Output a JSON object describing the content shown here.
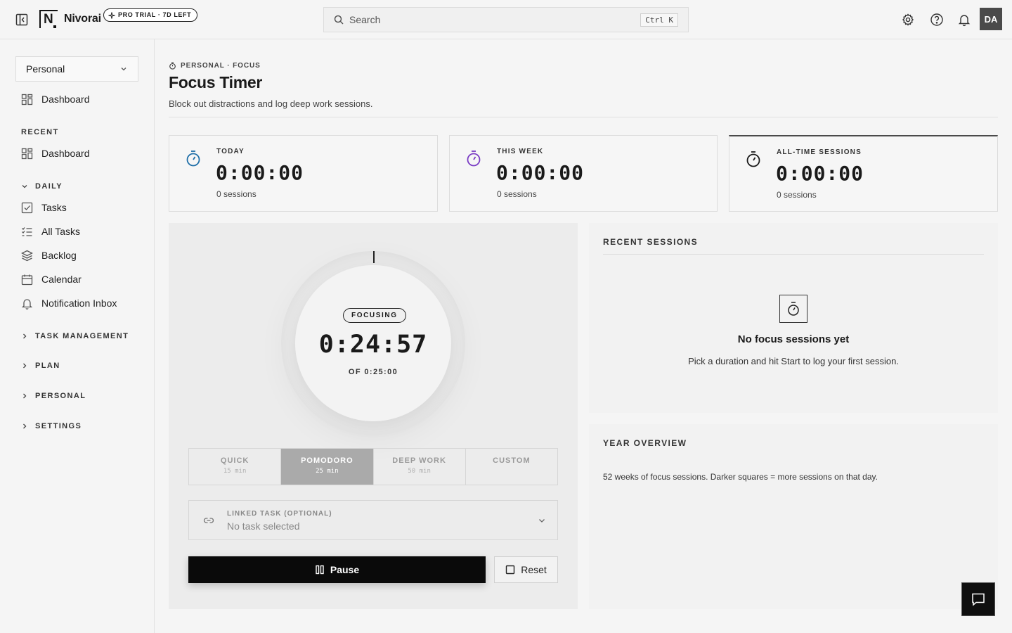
{
  "app": {
    "brand": "Nivorai",
    "logo_letter": "N",
    "trial_badge": "PRO TRIAL · 7D LEFT"
  },
  "search": {
    "placeholder": "Search",
    "shortcut": "Ctrl K"
  },
  "user": {
    "initials": "DA"
  },
  "sidebar": {
    "workspace": "Personal",
    "dashboard": "Dashboard",
    "recent_label": "RECENT",
    "recent_items": [
      "Dashboard"
    ],
    "daily_label": "DAILY",
    "daily_items": [
      "Tasks",
      "All Tasks",
      "Backlog",
      "Calendar",
      "Notification Inbox"
    ],
    "groups": [
      "TASK MANAGEMENT",
      "PLAN",
      "PERSONAL",
      "SETTINGS"
    ]
  },
  "page": {
    "breadcrumb": "PERSONAL · FOCUS",
    "title": "Focus Timer",
    "subtitle": "Block out distractions and log deep work sessions."
  },
  "stats": [
    {
      "label": "TODAY",
      "value": "0:00:00",
      "sub": "0 sessions",
      "color": "#1f6fa8"
    },
    {
      "label": "THIS WEEK",
      "value": "0:00:00",
      "sub": "0 sessions",
      "color": "#7a3cc4"
    },
    {
      "label": "ALL-TIME SESSIONS",
      "value": "0:00:00",
      "sub": "0 sessions",
      "color": "#1a1a1a"
    }
  ],
  "timer": {
    "status": "FOCUSING",
    "remaining": "0:24:57",
    "of": "OF 0:25:00"
  },
  "presets": [
    {
      "name": "QUICK",
      "min": "15 min",
      "selected": false
    },
    {
      "name": "POMODORO",
      "min": "25 min",
      "selected": true
    },
    {
      "name": "DEEP WORK",
      "min": "50 min",
      "selected": false
    },
    {
      "name": "CUSTOM",
      "min": "",
      "selected": false
    }
  ],
  "linked_task": {
    "label": "LINKED TASK (OPTIONAL)",
    "value": "No task selected"
  },
  "actions": {
    "pause": "Pause",
    "reset": "Reset"
  },
  "recent_sessions": {
    "heading": "RECENT SESSIONS",
    "empty_title": "No focus sessions yet",
    "empty_sub": "Pick a duration and hit Start to log your first session."
  },
  "year_overview": {
    "heading": "YEAR OVERVIEW",
    "sub": "52 weeks of focus sessions. Darker squares = more sessions on that day."
  }
}
